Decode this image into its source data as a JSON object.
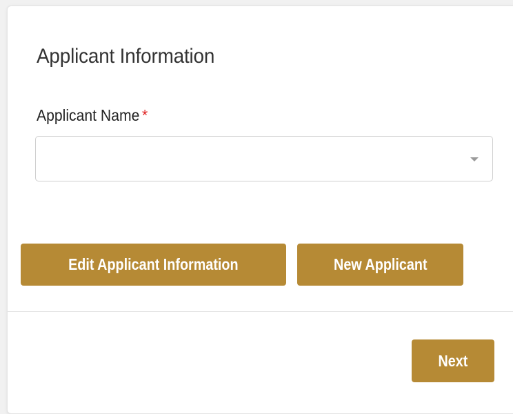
{
  "applicant_section": {
    "title": "Applicant Information",
    "name_field": {
      "label": "Applicant Name",
      "required_marker": "*",
      "selected_value": ""
    }
  },
  "actions": {
    "edit_label": "Edit Applicant Information",
    "new_label": "New Applicant"
  },
  "footer": {
    "next_label": "Next"
  },
  "colors": {
    "button_bg": "#b68a35",
    "button_text": "#ffffff",
    "required": "#e02424"
  },
  "icons": {
    "dropdown": "caret-down-icon"
  }
}
